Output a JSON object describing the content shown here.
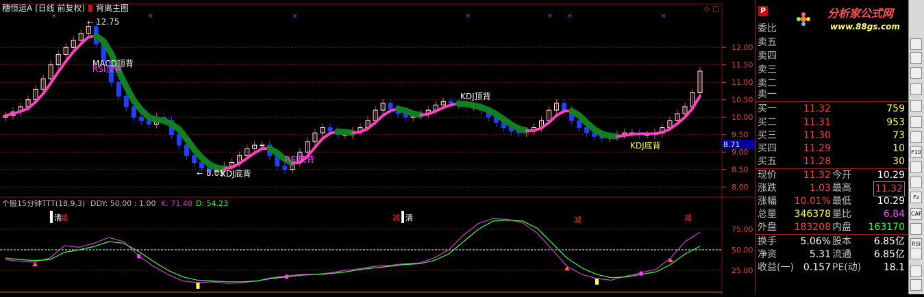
{
  "window": {
    "title": "穗恒运A (日线 前复权)",
    "main_indicator": "背离主图"
  },
  "colors": {
    "up": "#ff3c3c",
    "down": "#2040ff",
    "bg": "#000000",
    "grid": "#8a1010",
    "rise_ribbon": "#ff40c0",
    "fall_ribbon": "#108020",
    "label_yellow": "#ffff40",
    "k_line": "#d040d0",
    "d_line": "#40ff40"
  },
  "price_chart": {
    "y_ticks": [
      "12.00",
      "11.50",
      "11.00",
      "10.50",
      "10.00",
      "9.50",
      "9.00",
      "8.50",
      "8.00"
    ],
    "current_price_tag": "8.71",
    "high_marker": "12.75",
    "low_marker": "8.05",
    "annotations": [
      {
        "text": "MACD顶背",
        "color": "white"
      },
      {
        "text": "RSI顶背",
        "color": "#ff40ff"
      },
      {
        "text": "KDJ顶背",
        "color": "white"
      },
      {
        "text": "KDJ底背",
        "color": "white"
      },
      {
        "text": "RSI底背",
        "color": "#ff40ff"
      },
      {
        "text": "KDJ底背",
        "color": "#ffff40"
      }
    ]
  },
  "sub_chart": {
    "title": "个股15分钟TTT(18,9,3)",
    "ddy_label": "DDY: 50.00 : 1.00",
    "k_label": "K: 71.48",
    "d_label": "D: 54.23",
    "y_ticks": [
      "75.00",
      "50.00",
      "25.00"
    ],
    "signals": [
      "清",
      "减",
      "减",
      "清",
      "减",
      "减"
    ]
  },
  "chart_data": {
    "type": "line",
    "title": "个股15分钟TTT(18,9,3)",
    "series": [
      {
        "name": "K",
        "values": [
          38,
          36,
          35,
          40,
          55,
          53,
          58,
          65,
          60,
          43,
          30,
          20,
          12,
          10,
          11,
          9,
          10,
          12,
          16,
          18,
          20,
          20,
          22,
          25,
          27,
          30,
          31,
          33,
          34,
          40,
          50,
          68,
          82,
          88,
          87,
          83,
          70,
          50,
          30,
          20,
          15,
          13,
          18,
          22,
          26,
          40,
          60,
          71.48
        ]
      },
      {
        "name": "D",
        "values": [
          40,
          38,
          37,
          38,
          47,
          50,
          54,
          60,
          58,
          48,
          36,
          25,
          17,
          13,
          12,
          11,
          11,
          12,
          15,
          17,
          19,
          20,
          21,
          23,
          26,
          28,
          30,
          32,
          33,
          37,
          45,
          60,
          75,
          85,
          86,
          85,
          76,
          58,
          40,
          28,
          20,
          16,
          17,
          20,
          23,
          32,
          45,
          54.23
        ]
      }
    ],
    "ylim": [
      0,
      100
    ],
    "price_series": {
      "name": "close",
      "values": [
        10.05,
        10.15,
        10.3,
        10.5,
        10.8,
        11.1,
        11.5,
        11.8,
        12.0,
        12.2,
        12.4,
        12.6,
        12.1,
        11.6,
        11.0,
        10.6,
        10.3,
        10.0,
        9.9,
        9.8,
        10.0,
        9.9,
        9.5,
        9.2,
        8.9,
        8.7,
        8.55,
        8.45,
        8.5,
        8.6,
        8.7,
        8.9,
        9.1,
        9.2,
        9.2,
        8.9,
        8.6,
        8.5,
        8.7,
        9.0,
        9.3,
        9.55,
        9.7,
        9.6,
        9.5,
        9.5,
        9.6,
        9.7,
        9.9,
        10.2,
        10.4,
        10.25,
        10.1,
        10.0,
        10.05,
        10.1,
        10.2,
        10.35,
        10.45,
        10.4,
        10.35,
        10.3,
        10.3,
        10.2,
        10.0,
        9.85,
        9.7,
        9.6,
        9.55,
        9.6,
        9.7,
        9.9,
        10.2,
        10.4,
        10.2,
        9.9,
        9.7,
        9.55,
        9.45,
        9.4,
        9.45,
        9.5,
        9.55,
        9.55,
        9.5,
        9.5,
        9.55,
        9.7,
        9.9,
        10.1,
        10.3,
        10.7,
        11.32
      ],
      "ylim": [
        7.75,
        13.2
      ]
    }
  },
  "quote": {
    "header_label": "委比",
    "sell": [
      {
        "label": "卖五"
      },
      {
        "label": "卖四"
      },
      {
        "label": "卖三"
      },
      {
        "label": "卖二"
      },
      {
        "label": "卖一"
      }
    ],
    "buy": [
      {
        "label": "买一",
        "price": "11.32",
        "vol": "759"
      },
      {
        "label": "买二",
        "price": "11.31",
        "vol": "953"
      },
      {
        "label": "买三",
        "price": "11.30",
        "vol": "73"
      },
      {
        "label": "买四",
        "price": "11.29",
        "vol": "10"
      },
      {
        "label": "买五",
        "price": "11.28",
        "vol": "30"
      }
    ],
    "stats": [
      {
        "l1": "现价",
        "v1": "11.32",
        "c1": "red",
        "l2": "今开",
        "v2": "10.29",
        "c2": "wht"
      },
      {
        "l1": "涨跌",
        "v1": "1.03",
        "c1": "red",
        "l2": "最高",
        "v2": "11.32",
        "c2": "red"
      },
      {
        "l1": "涨幅",
        "v1": "10.01%",
        "c1": "red",
        "l2": "最低",
        "v2": "10.29",
        "c2": "wht"
      },
      {
        "l1": "总量",
        "v1": "346378",
        "c1": "yel",
        "l2": "量比",
        "v2": "6.84",
        "c2": "mag"
      },
      {
        "l1": "外盘",
        "v1": "183208",
        "c1": "red",
        "l2": "内盘",
        "v2": "163170",
        "c2": "grn"
      }
    ],
    "finance": [
      {
        "l1": "换手",
        "v1": "5.06%",
        "l2": "股本",
        "v2": "6.85亿"
      },
      {
        "l1": "净资",
        "v1": "5.31",
        "l2": "流通",
        "v2": "6.85亿"
      },
      {
        "l1": "收益(一)",
        "v1": "0.157",
        "l2": "PE(动)",
        "v2": "18.1"
      }
    ]
  },
  "logo": {
    "main": "分析家公式网",
    "url": "www.88gs.com",
    "p_mark": "P"
  },
  "toolbar": {
    "buttons": [
      "down-arrow-icon",
      "expand-icon",
      "table-icon",
      "grid-icon",
      "line-chart-icon",
      "bar-chart-icon",
      "kline-icon",
      "f10-icon",
      "financial-icon",
      "capital-icon",
      "fz-icon",
      "cap-icon",
      "calc-icon",
      "rsi-icon",
      "volume-icon",
      "toggle-icon",
      "move-icon"
    ],
    "labels": [
      "",
      "",
      "",
      "",
      "",
      "",
      "",
      "F10",
      "",
      "",
      "Fz",
      "CAP",
      "",
      "RSI",
      "",
      "",
      ""
    ]
  }
}
